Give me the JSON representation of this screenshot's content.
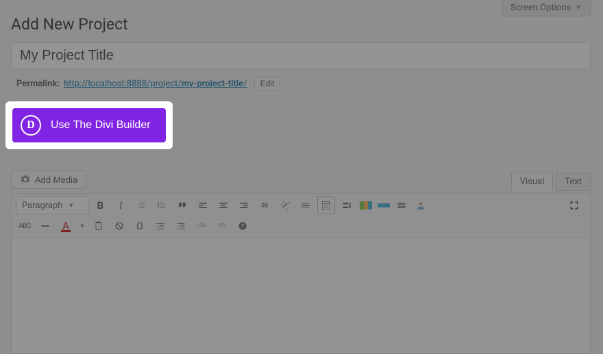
{
  "header": {
    "screen_options": "Screen Options",
    "page_title": "Add New Project"
  },
  "title": {
    "value": "My Project Title"
  },
  "permalink": {
    "label": "Permalink:",
    "base_url": "http://localhost:8888/project/",
    "slug": "my-project-title",
    "trail": "/",
    "edit_label": "Edit"
  },
  "divi": {
    "icon_letter": "D",
    "button_label": "Use The Divi Builder"
  },
  "media": {
    "add_label": "Add Media"
  },
  "editor_tabs": {
    "visual": "Visual",
    "text": "Text",
    "active": "visual"
  },
  "toolbar": {
    "format": "Paragraph",
    "abc": "ABC"
  }
}
